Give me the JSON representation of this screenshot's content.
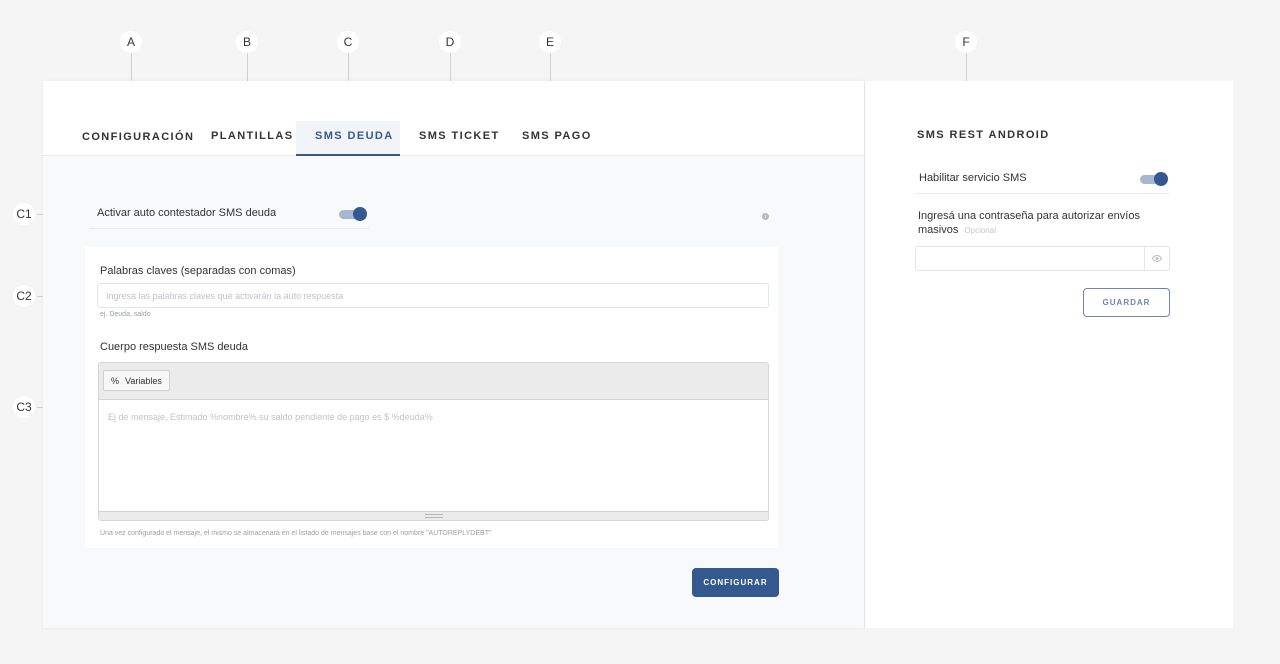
{
  "callouts": {
    "a": "A",
    "b": "B",
    "c": "C",
    "d": "D",
    "e": "E",
    "f": "F",
    "c1": "C1",
    "c2": "C2",
    "c3": "C3"
  },
  "tabs": [
    {
      "label": "CONFIGURACIÓN"
    },
    {
      "label": "PLANTILLAS"
    },
    {
      "label": "SMS DEUDA"
    },
    {
      "label": "SMS TICKET"
    },
    {
      "label": "SMS PAGO"
    }
  ],
  "sms_deuda": {
    "auto_reply_label": "Activar auto contestador SMS deuda",
    "keywords_label": "Palabras claves (separadas con comas)",
    "keywords_placeholder": "Ingresá las palabras claves que activarán la auto respuesta",
    "keywords_hint": "ej. Deuda, saldo",
    "body_label": "Cuerpo respuesta SMS deuda",
    "variables_symbol": "%",
    "variables_label": "Variables",
    "body_placeholder": "Ej de mensaje, Estimado %nombre% su saldo pendiente de pago es $ %deuda%",
    "footer_note": "Una vez configurado el mensaje, el mismo se almacenará en el listado de mensajes base con el nombre \"AUTOREPLYDEBT\"",
    "configure_button": "CONFIGURAR"
  },
  "sms_rest": {
    "title": "SMS REST ANDROID",
    "enable_label": "Habilitar servicio SMS",
    "password_label": "Ingresá una contraseña para autorizar envíos masivos",
    "optional": "Opcional",
    "save_button": "GUARDAR"
  },
  "colors": {
    "accent": "#34598f"
  }
}
